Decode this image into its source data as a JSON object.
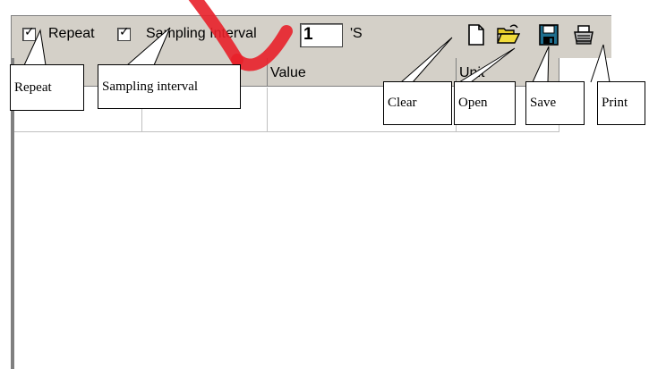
{
  "toolbar": {
    "repeat_checked": "✓",
    "repeat_label": "Repeat",
    "sampling_checked": "✓",
    "sampling_label": "Sampling Interval",
    "interval_value": "1",
    "interval_unit": "'S",
    "icons": [
      "new-document-icon",
      "open-folder-icon",
      "save-disk-icon",
      "print-icon"
    ]
  },
  "table": {
    "columns": [
      "",
      "",
      "Value",
      "Unit"
    ]
  },
  "callouts": {
    "repeat": "Repeat",
    "sampling": "Sampling interval",
    "clear": "Clear",
    "open": "Open",
    "save": "Save",
    "print": "Print"
  },
  "colors": {
    "watermark": "#e8202a",
    "toolbar_bg": "#d4d0c8",
    "save_icon": "#1f6f8f",
    "folder_icon": "#e6cc2a"
  }
}
